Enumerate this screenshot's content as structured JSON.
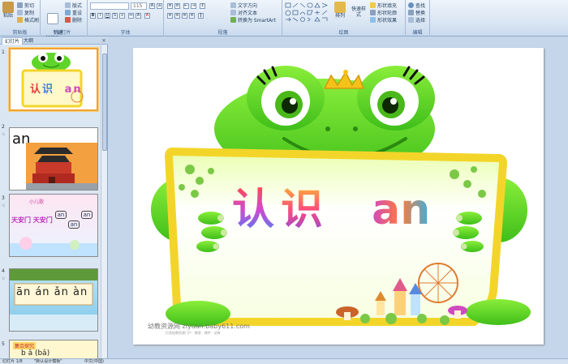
{
  "ribbon": {
    "clipboard": {
      "label": "剪贴板",
      "paste": "粘贴",
      "cut": "剪切",
      "copy": "复制",
      "format_painter": "格式刷"
    },
    "slides": {
      "label": "幻灯片",
      "new_slide": "新建\n幻灯片",
      "layout": "版式",
      "reset": "重设",
      "delete": "删除"
    },
    "font": {
      "label": "字体",
      "font_size": "115"
    },
    "paragraph": {
      "label": "段落",
      "text_direction": "文字方向",
      "align_text": "对齐文本",
      "smartart": "转换为 SmartArt"
    },
    "drawing": {
      "label": "绘图",
      "arrange": "排列",
      "quick_styles": "快速样式",
      "shape_fill": "形状填充",
      "shape_outline": "形状轮廓",
      "shape_effects": "形状效果"
    },
    "editing": {
      "label": "编辑",
      "find": "查找",
      "replace": "替换",
      "select": "选择"
    }
  },
  "panel": {
    "tab_slides": "幻灯片",
    "tab_outline": "大纲",
    "thumbs": [
      {
        "num": "1",
        "title": "认识 an"
      },
      {
        "num": "2",
        "title": "an"
      },
      {
        "num": "3",
        "title": "天安门 天安门",
        "sub1": "小儿歌",
        "chips": [
          "an",
          "an",
          "an"
        ]
      },
      {
        "num": "4",
        "title": "ān án ǎn àn"
      },
      {
        "num": "5",
        "title": "b  ǎ (bǎ)",
        "sub1": "集合探究"
      }
    ]
  },
  "slide": {
    "title_chars": [
      "认",
      "识"
    ],
    "title_pinyin": "an",
    "watermark": "幼教资源网 ziyuan.baby611.com",
    "watermark_sub": "打造幼教资源门户 · 教案 · 课件 · 试卷"
  },
  "status": {
    "slide_count": "幻灯片 1/8",
    "theme": "\"默认设计模板\"",
    "language": "中文(中国)"
  },
  "colors": {
    "frog_green": "#5fd42a",
    "frame_yellow": "#f3d52a",
    "ribbon_bg": "#d7e4f2",
    "selected_thumb": "#f0a233"
  }
}
